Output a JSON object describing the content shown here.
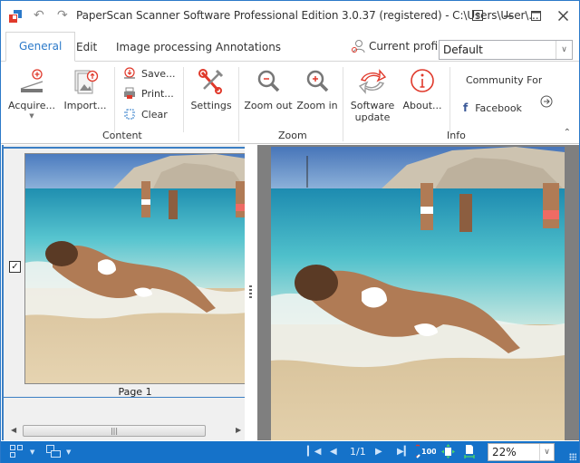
{
  "window": {
    "title": "PaperScan Scanner Software Professional Edition 3.0.37 (registered) - C:\\Users\\User\\...",
    "accent_color": "#2b79c9",
    "statusbar_color": "#1572c9"
  },
  "quick_access": {
    "undo_icon": "undo-icon",
    "redo_icon": "redo-icon"
  },
  "window_controls": [
    "restore-ribbon-icon",
    "minimize-icon",
    "maximize-icon",
    "close-icon"
  ],
  "tabs": [
    {
      "label": "General",
      "active": true
    },
    {
      "label": "Edit",
      "active": false
    },
    {
      "label": "Image processing",
      "active": false
    },
    {
      "label": "Annotations",
      "active": false
    }
  ],
  "profile": {
    "label": "Current profile:",
    "value": "Default"
  },
  "ribbon": {
    "groups": {
      "content": {
        "label": "Content",
        "acquire": "Acquire...",
        "import": "Import...",
        "save": "Save...",
        "print": "Print...",
        "clear": "Clear",
        "settings": "Settings"
      },
      "zoom": {
        "label": "Zoom",
        "zoom_out": "Zoom out",
        "zoom_in": "Zoom in"
      },
      "info": {
        "label": "Info",
        "software_update_line1": "Software",
        "software_update_line2": "update",
        "about": "About...",
        "community": "Community For",
        "facebook": "Facebook"
      }
    }
  },
  "thumbnails": [
    {
      "label": "Page 1",
      "checked": true,
      "selected": true
    }
  ],
  "statusbar": {
    "page_indicator": "1/1",
    "zoom_value": "22%"
  }
}
